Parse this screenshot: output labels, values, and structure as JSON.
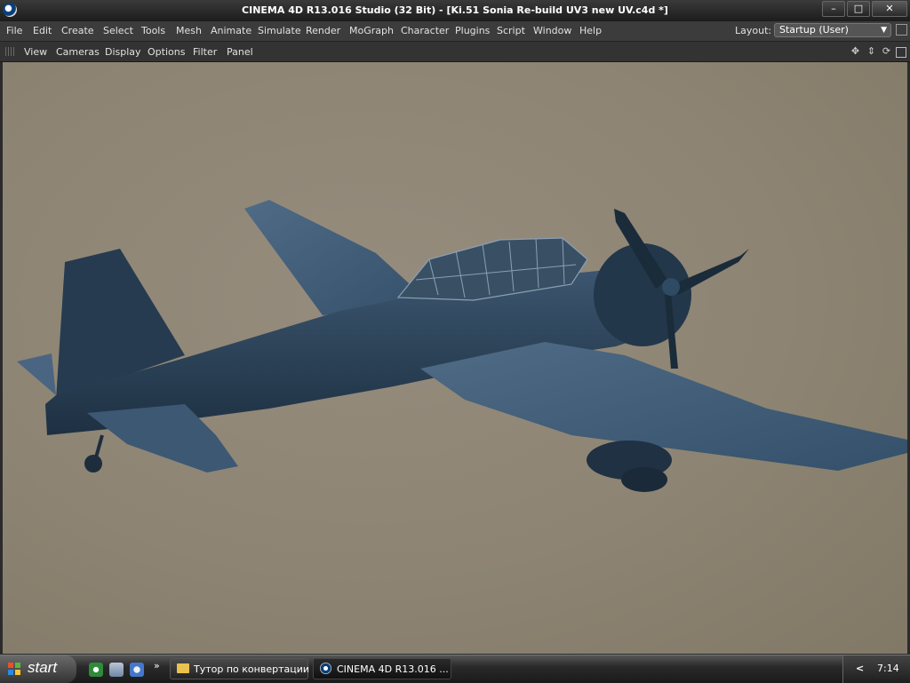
{
  "window": {
    "title": "CINEMA 4D R13.016 Studio (32 Bit) - [Ki.51 Sonia Re-build UV3 new UV.c4d *]",
    "controls": {
      "minimize": "–",
      "maximize": "□",
      "close": "✕"
    }
  },
  "menubar": {
    "items": [
      "File",
      "Edit",
      "Create",
      "Select",
      "Tools",
      "Mesh",
      "Animate",
      "Simulate",
      "Render",
      "MoGraph",
      "Character",
      "Plugins",
      "Script",
      "Window",
      "Help"
    ],
    "layout_label": "Layout:",
    "layout_value": "Startup (User)"
  },
  "viewport_menu": {
    "items": [
      "View",
      "Cameras",
      "Display",
      "Options",
      "Filter",
      "Panel"
    ],
    "nav_icons": [
      "move-icon",
      "dolly-icon",
      "rotate-icon",
      "maximize-icon"
    ]
  },
  "viewport": {
    "background_color": "#8d8473",
    "model_color": "#2c4358"
  },
  "taskbar": {
    "start_label": "start",
    "quicklaunch_more": "»",
    "tasks": [
      "Тутор по конвертации",
      "CINEMA 4D R13.016 ..."
    ],
    "tray_arrow": "<",
    "clock": "7:14"
  }
}
